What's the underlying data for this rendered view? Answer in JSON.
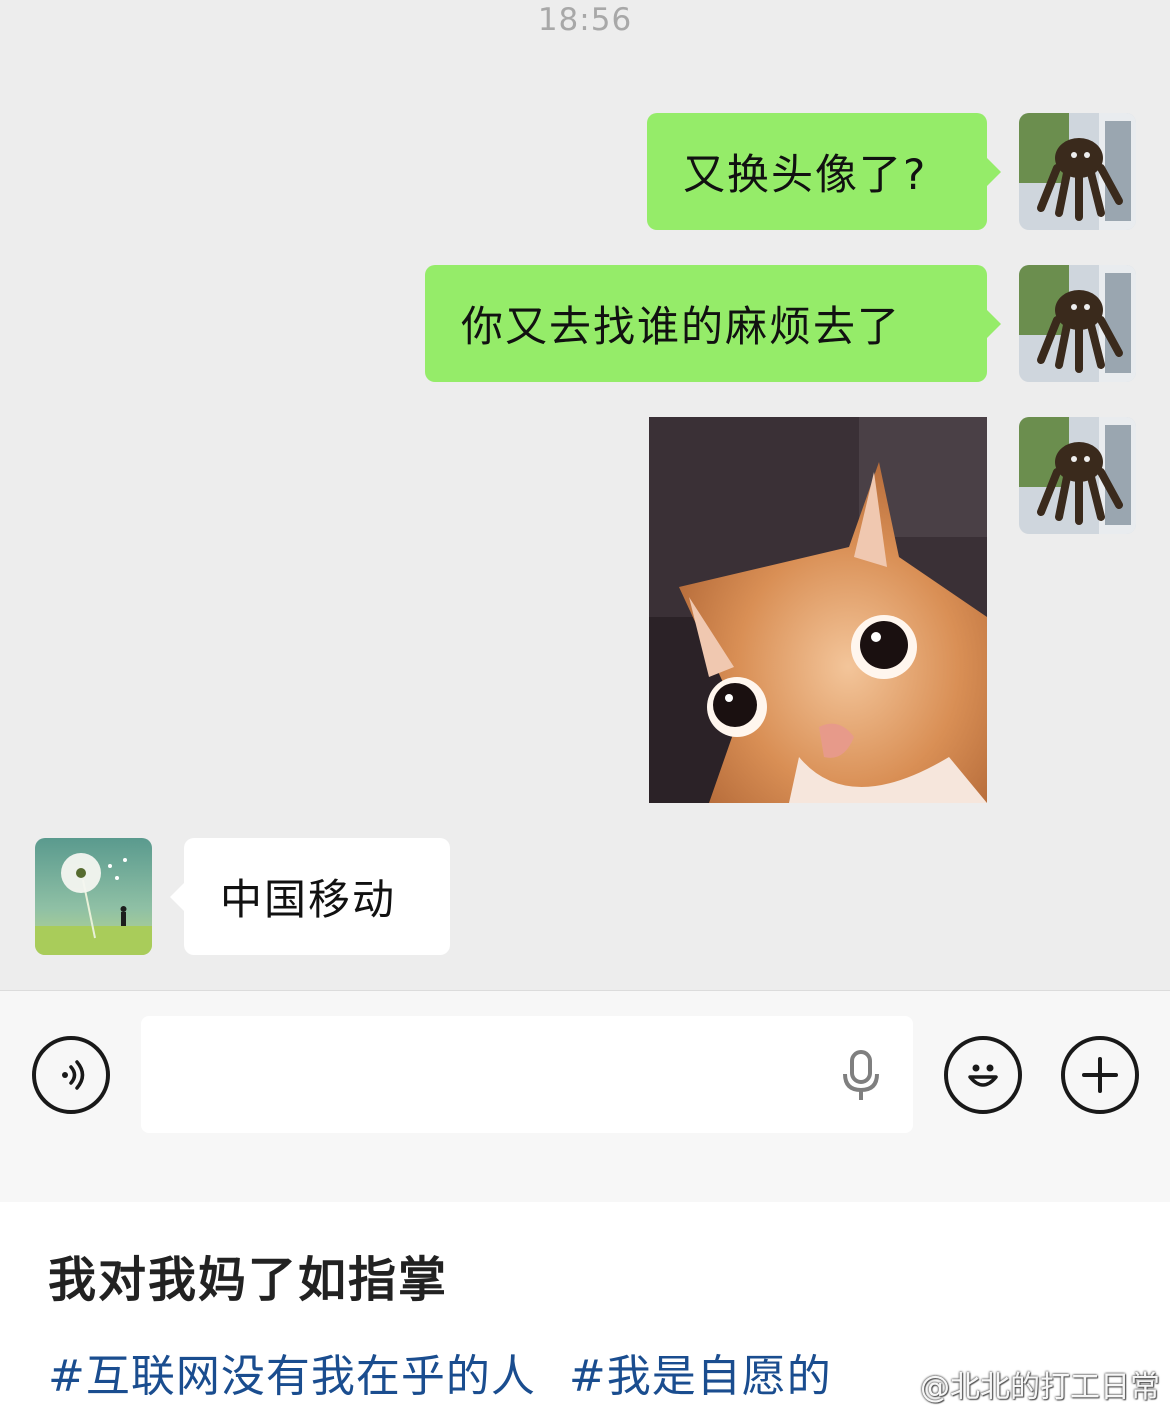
{
  "chat": {
    "timestamp": "18:56",
    "messages": [
      {
        "from": "self",
        "type": "text",
        "text": "又换头像了?"
      },
      {
        "from": "self",
        "type": "text",
        "text": "你又去找谁的麻烦去了"
      },
      {
        "from": "self",
        "type": "image",
        "image": "orange-cat-photo"
      },
      {
        "from": "other",
        "type": "text",
        "text": "中国移动"
      }
    ],
    "self_avatar": "octopus-hand-avatar",
    "other_avatar": "dandelion-avatar"
  },
  "input_bar": {
    "voice_icon": "voice-toggle-icon",
    "mic_icon": "mic-icon",
    "emoji_icon": "emoji-icon",
    "plus_icon": "plus-icon",
    "value": ""
  },
  "post": {
    "caption": "我对我妈了如指掌",
    "tags": [
      "#互联网没有我在乎的人",
      "#我是自愿的"
    ],
    "watermark": "@北北的打工日常"
  },
  "colors": {
    "chat_bg": "#ededed",
    "bubble_self": "#95ec69",
    "bubble_other": "#ffffff",
    "tag_link": "#1a4d8f"
  }
}
